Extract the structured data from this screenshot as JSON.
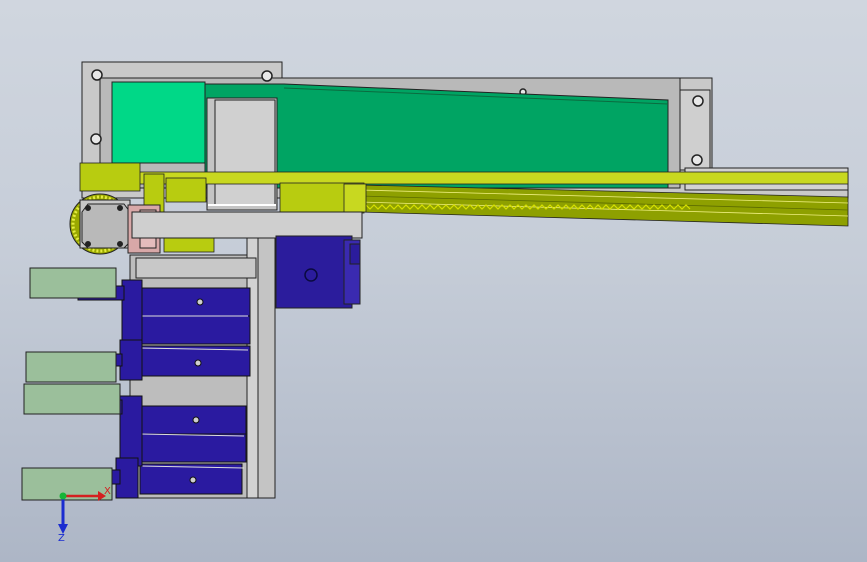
{
  "viewport": {
    "background_top": "#d0d6df",
    "background_bottom": "#adb6c6"
  },
  "triad": {
    "x_label": "X",
    "z_label": "Z",
    "x_color": "#d42020",
    "z_color": "#1a2cd0",
    "origin_color": "#17b537"
  },
  "colors": {
    "frame_gray": "#c8c8c8",
    "belt_green": "#00a060",
    "motor_green": "#00d080",
    "rail_yellow": "#b8cc10",
    "cylinder_blue": "#2a1aa0",
    "jaw_sage": "#9bbf9b",
    "bracket_pink": "#d8a8a8",
    "servo_blue": "#2b1c9c"
  }
}
